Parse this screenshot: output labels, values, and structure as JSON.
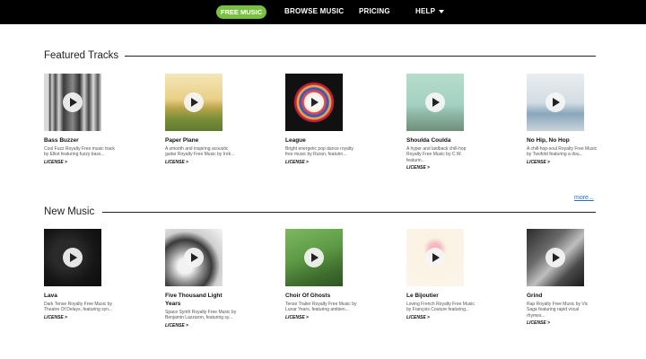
{
  "nav": {
    "items": [
      "FREE MUSIC",
      "BROWSE MUSIC",
      "PRICING",
      "HELP"
    ],
    "active_color": "#7ac043"
  },
  "featured": {
    "title": "Featured Tracks",
    "tracks": [
      {
        "title": "Bass Buzzer",
        "desc": "Cool Fuzz Royalty Free music track by Elliot featuring fuzzy bass...",
        "license": "LICENSE >"
      },
      {
        "title": "Paper Plane",
        "desc": "A smooth and inspiring acoustic guitar Royalty Free Music by Irok...",
        "license": "LICENSE >"
      },
      {
        "title": "League",
        "desc": "Bright energetic pop dance royalty free music by Ruran, featurin...",
        "license": "LICENSE >"
      },
      {
        "title": "Shoulda Coulda",
        "desc": "A hyper and laidback chill-hop Royalty Free Music by C.W. featurin...",
        "license": "LICENSE >"
      },
      {
        "title": "No Hip, No Hop",
        "desc": "A chill-hop-soul Royalty Free Music by Twofold featuring a dou...",
        "license": "LICENSE >"
      }
    ]
  },
  "more_label": "more...",
  "new_music": {
    "title": "New Music",
    "tracks": [
      {
        "title": "Lava",
        "desc": "Dark Tense Royalty Free Music by Theatre Of Delays, featuring syn...",
        "license": "LICENSE >"
      },
      {
        "title": "Five Thousand Light Years",
        "desc": "Space Synth Royalty Free Music by Benjamin Lazzaron, featuring sy...",
        "license": "LICENSE >"
      },
      {
        "title": "Choir Of Ghosts",
        "desc": "Tense Trailer Royalty Free Music by Lunar Years, featuring ambien...",
        "license": "LICENSE >"
      },
      {
        "title": "Le Bijoutier",
        "desc": "Loving French Royalty Free Music by François Couture featuring...",
        "license": "LICENSE >"
      },
      {
        "title": "Grind",
        "desc": "Rap Royalty Free Music by Vic Saga featuring rapid vocal rhymes...",
        "license": "LICENSE >"
      }
    ]
  }
}
